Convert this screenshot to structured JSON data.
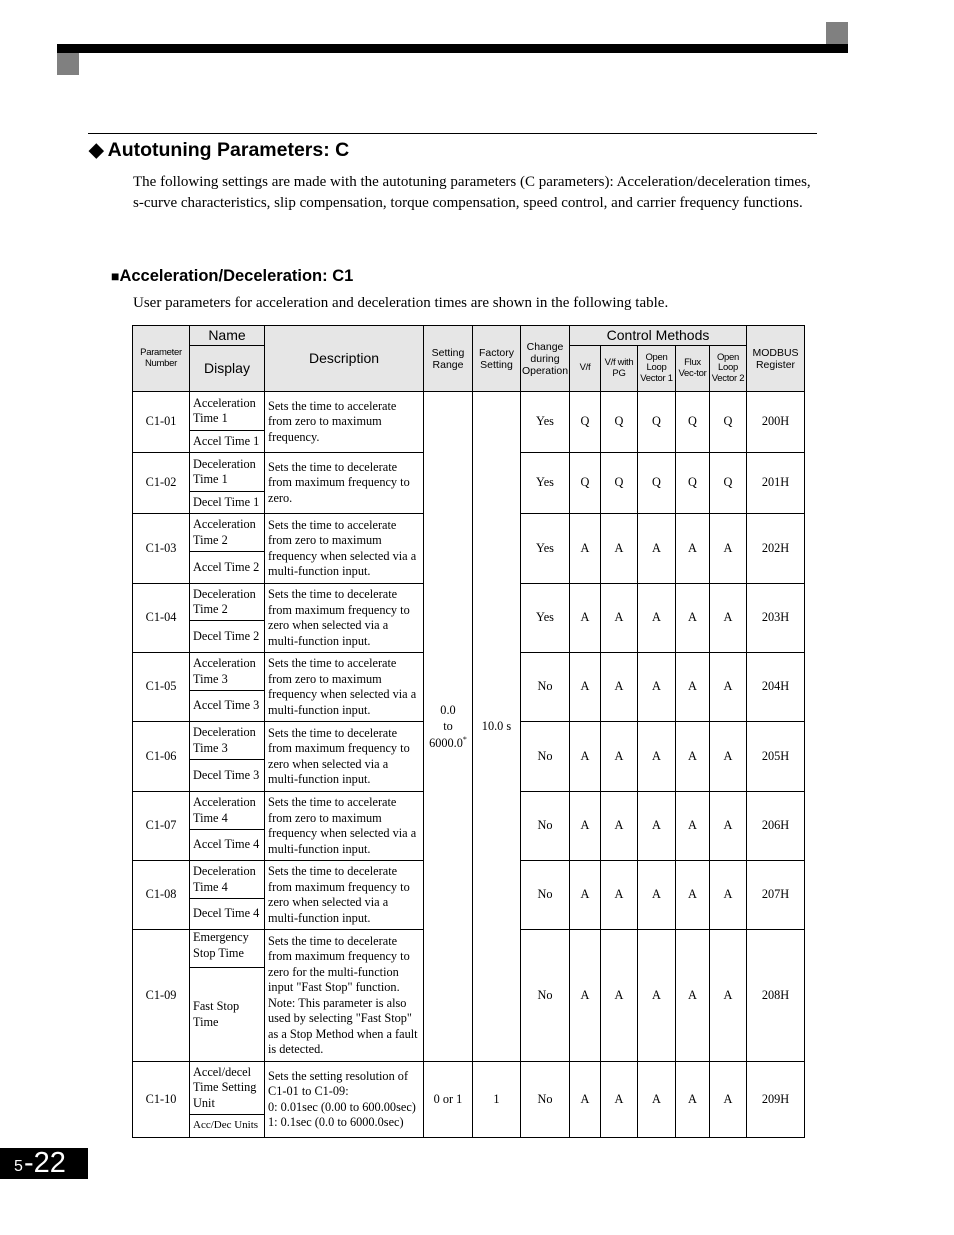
{
  "section": {
    "title": "Autotuning Parameters: C",
    "title_icon": "diamond-icon",
    "intro": "The following settings are made with the autotuning parameters (C parameters): Acceleration/deceleration times, s-curve characteristics, slip compensation, torque compensation, speed control, and carrier frequency functions."
  },
  "subsection": {
    "title": "Acceleration/Deceleration: C1",
    "title_icon": "square-bullet-icon",
    "lead": "User parameters for acceleration and deceleration times are shown in the following table."
  },
  "table": {
    "headers": {
      "param_number": "Parameter Number",
      "name": "Name",
      "display": "Display",
      "description": "Description",
      "setting_range": "Setting Range",
      "factory_setting": "Factory Setting",
      "change_during_operation": "Change during Operation",
      "control_methods": "Control Methods",
      "methods": [
        "V/f",
        "V/f with PG",
        "Open Loop Vector 1",
        "Flux Vec-tor",
        "Open Loop Vector 2"
      ],
      "modbus": "MODBUS Register"
    },
    "shared_setting_range": {
      "line1": "0.0",
      "line2": "to",
      "line3": "6000.0",
      "footnote_mark": "*"
    },
    "shared_factory_setting": "10.0 s",
    "rows": [
      {
        "number": "C1-01",
        "name": "Acceleration Time 1",
        "display": "Accel Time 1",
        "description": "Sets the time to accelerate from zero to maximum frequency.",
        "change": "Yes",
        "methods": [
          "Q",
          "Q",
          "Q",
          "Q",
          "Q"
        ],
        "modbus": "200H"
      },
      {
        "number": "C1-02",
        "name": "Deceleration Time 1",
        "display": "Decel Time 1",
        "description": "Sets the time to decelerate from maximum frequency to zero.",
        "change": "Yes",
        "methods": [
          "Q",
          "Q",
          "Q",
          "Q",
          "Q"
        ],
        "modbus": "201H"
      },
      {
        "number": "C1-03",
        "name": "Acceleration Time 2",
        "display": "Accel Time 2",
        "description": "Sets the time to accelerate from zero to maximum frequency when selected via a multi-function input.",
        "change": "Yes",
        "methods": [
          "A",
          "A",
          "A",
          "A",
          "A"
        ],
        "modbus": "202H"
      },
      {
        "number": "C1-04",
        "name": "Deceleration Time 2",
        "display": "Decel Time 2",
        "description": "Sets the time to decelerate from maximum frequency to zero when selected via a multi-function input.",
        "change": "Yes",
        "methods": [
          "A",
          "A",
          "A",
          "A",
          "A"
        ],
        "modbus": "203H"
      },
      {
        "number": "C1-05",
        "name": "Acceleration Time 3",
        "display": "Accel Time 3",
        "description": "Sets the time to accelerate from zero to maximum frequency when selected via a multi-function input.",
        "change": "No",
        "methods": [
          "A",
          "A",
          "A",
          "A",
          "A"
        ],
        "modbus": "204H"
      },
      {
        "number": "C1-06",
        "name": "Deceleration Time 3",
        "display": "Decel Time 3",
        "description": "Sets the time to decelerate from maximum frequency to zero when selected via a multi-function input.",
        "change": "No",
        "methods": [
          "A",
          "A",
          "A",
          "A",
          "A"
        ],
        "modbus": "205H"
      },
      {
        "number": "C1-07",
        "name": "Acceleration Time 4",
        "display": "Accel Time 4",
        "description": "Sets the time to accelerate from zero to maximum frequency when selected via a multi-function input.",
        "change": "No",
        "methods": [
          "A",
          "A",
          "A",
          "A",
          "A"
        ],
        "modbus": "206H"
      },
      {
        "number": "C1-08",
        "name": "Deceleration Time 4",
        "display": "Decel Time 4",
        "description": "Sets the time to decelerate from maximum frequency to zero when selected via a multi-function input.",
        "change": "No",
        "methods": [
          "A",
          "A",
          "A",
          "A",
          "A"
        ],
        "modbus": "207H"
      },
      {
        "number": "C1-09",
        "name": "Emergency Stop Time",
        "display": "Fast Stop Time",
        "description": "Sets the time to decelerate from maximum frequency to zero for the multi-function input \"Fast Stop\" function.",
        "note_label": "Note:",
        "note": "This parameter is also used by selecting \"Fast Stop\" as a Stop Method when a fault is detected.",
        "change": "No",
        "methods": [
          "A",
          "A",
          "A",
          "A",
          "A"
        ],
        "modbus": "208H"
      },
      {
        "number": "C1-10",
        "name": "Accel/decel Time Setting Unit",
        "display": "Acc/Dec Units",
        "description_lines": [
          "Sets the setting resolution of C1-01 to C1-09:",
          "0: 0.01sec (0.00 to 600.00sec)",
          "1: 0.1sec (0.0 to 6000.0sec)"
        ],
        "setting_range": "0 or 1",
        "factory_setting": "1",
        "change": "No",
        "methods": [
          "A",
          "A",
          "A",
          "A",
          "A"
        ],
        "modbus": "209H"
      }
    ]
  },
  "footer": {
    "chapter": "5",
    "page": "-22"
  }
}
